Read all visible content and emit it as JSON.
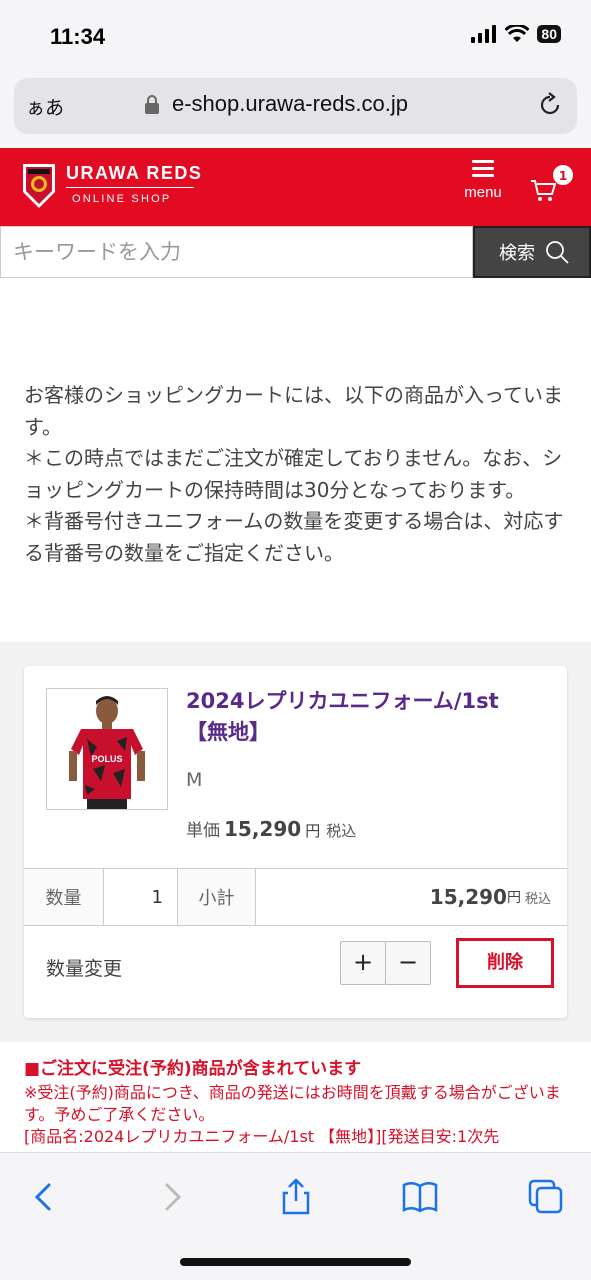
{
  "status_bar": {
    "time": "11:34",
    "battery": "80"
  },
  "browser": {
    "text_size": "ぁあ",
    "url": "e-shop.urawa-reds.co.jp"
  },
  "header": {
    "brand_line1": "URAWA REDS",
    "brand_line2": "ONLINE SHOP",
    "menu_label": "menu",
    "cart_count": "1",
    "brand_color": "#e20b21"
  },
  "search": {
    "placeholder": "キーワードを入力",
    "button_label": "検索"
  },
  "notice": {
    "line1": "お客様のショッピングカートには、以下の商品が入っています。",
    "line2": "＊この時点ではまだご注文が確定しておりません。なお、ショッピングカートの保持時間は30分となっております。",
    "line3": "＊背番号付きユニフォームの数量を変更する場合は、対応する背番号の数量をご指定ください。"
  },
  "cart_item": {
    "name_line1": "2024レプリカユニフォーム/1st",
    "name_line2": "【無地】",
    "size": "M",
    "unit_price_label": "単価",
    "unit_price": "15,290",
    "yen": "円",
    "tax_label": "税込",
    "qty_label": "数量",
    "qty": "1",
    "subtotal_label": "小計",
    "subtotal": "15,290",
    "change_qty_label": "数量変更",
    "plus": "+",
    "minus": "−",
    "delete_label": "削除",
    "jersey_sponsor": "POLUS"
  },
  "preorder": {
    "heading": "■ご注文に受注(予約)商品が含まれています",
    "body": "※受注(予約)商品につき、商品の発送にはお時間を頂戴する場合がございます。予めご了承ください。",
    "detail": "[商品名:2024レプリカユニフォーム/1st 【無地】][発送目安:1次先"
  },
  "toolbar": {
    "icons": [
      "back-icon",
      "forward-icon",
      "share-icon",
      "bookmarks-icon",
      "tabs-icon"
    ]
  }
}
